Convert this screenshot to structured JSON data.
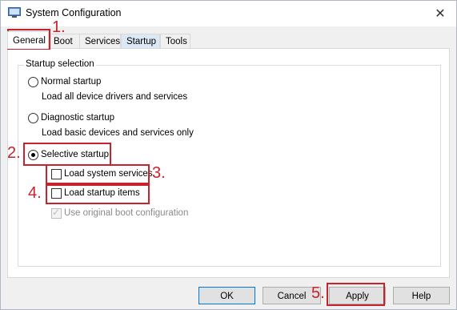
{
  "window": {
    "title": "System Configuration",
    "close_glyph": "✕",
    "icon": "system-config-icon"
  },
  "tabs": [
    {
      "label": "General",
      "active": true
    },
    {
      "label": "Boot",
      "active": false
    },
    {
      "label": "Services",
      "active": false
    },
    {
      "label": "Startup",
      "active": false
    },
    {
      "label": "Tools",
      "active": false
    }
  ],
  "startup_selection": {
    "legend": "Startup selection",
    "options": [
      {
        "label": "Normal startup",
        "description": "Load all device drivers and services",
        "checked": false
      },
      {
        "label": "Diagnostic startup",
        "description": "Load basic devices and services only",
        "checked": false
      },
      {
        "label": "Selective startup",
        "checked": true
      }
    ],
    "sub_options": [
      {
        "label": "Load system services",
        "checked": false,
        "disabled": false
      },
      {
        "label": "Load startup items",
        "checked": false,
        "disabled": false
      },
      {
        "label": "Use original boot configuration",
        "checked": true,
        "disabled": true
      }
    ]
  },
  "annotations": [
    "1.",
    "2.",
    "3.",
    "4.",
    "5."
  ],
  "annotation_color": "#c8232c",
  "buttons": {
    "ok": "OK",
    "cancel": "Cancel",
    "apply": "Apply",
    "help": "Help"
  }
}
